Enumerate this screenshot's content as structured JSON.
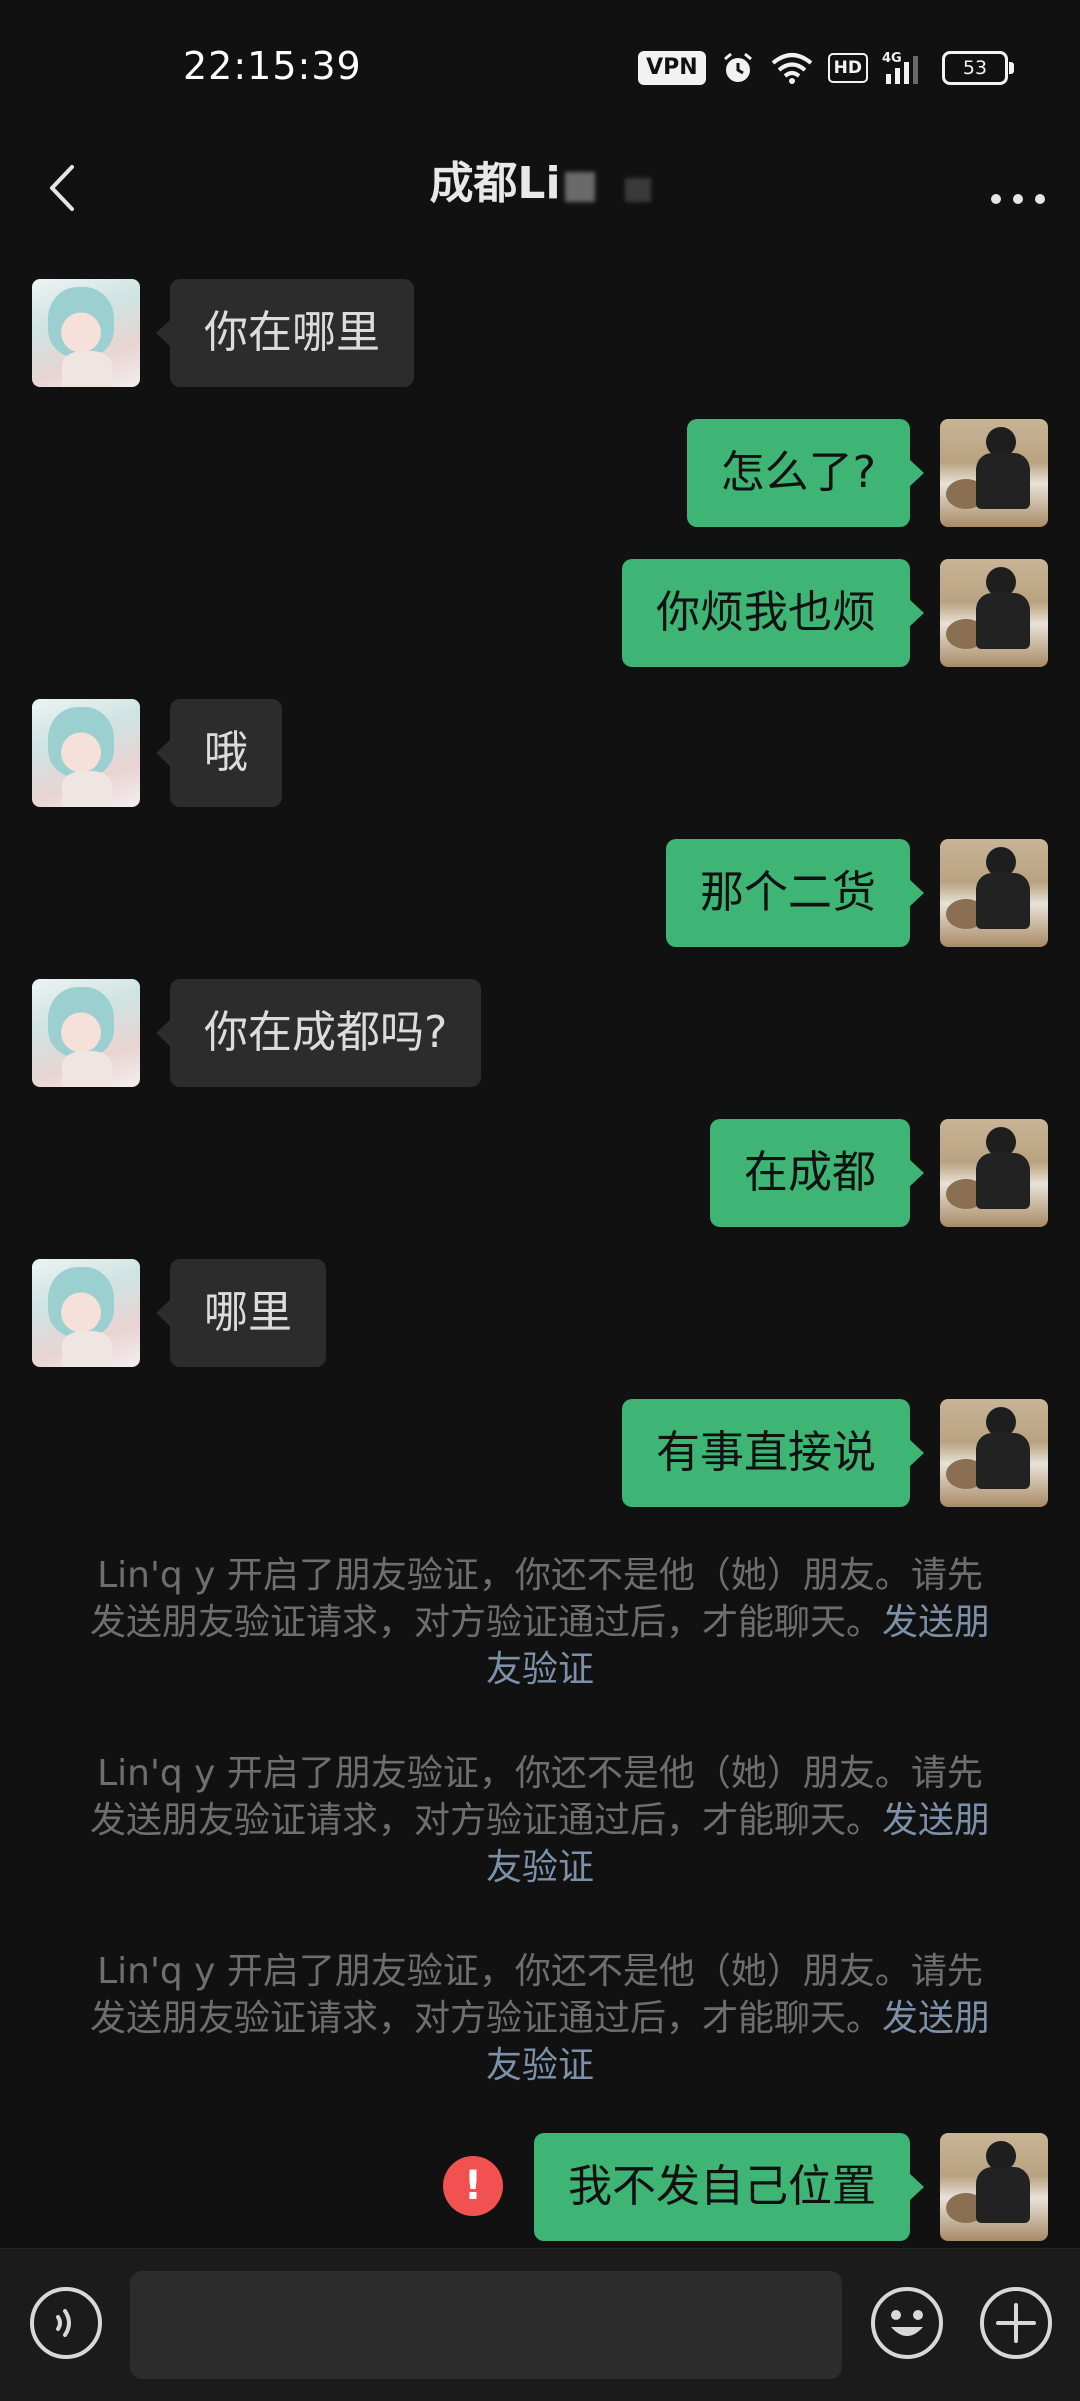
{
  "status_bar": {
    "time": "22:15:39",
    "vpn": "VPN",
    "hd": "HD",
    "network": "4G",
    "battery": "53",
    "icons": [
      "vpn-icon",
      "alarm-icon",
      "wifi-icon",
      "hd-icon",
      "signal-icon",
      "battery-icon"
    ]
  },
  "header": {
    "title": "成都Li",
    "back_icon": "chevron-left-icon",
    "more_icon": "more-horizontal-icon"
  },
  "messages": [
    {
      "side": "left",
      "text": "你在哪里"
    },
    {
      "side": "right",
      "text": "怎么了?"
    },
    {
      "side": "right",
      "text": "你烦我也烦"
    },
    {
      "side": "left",
      "text": "哦"
    },
    {
      "side": "right",
      "text": "那个二货"
    },
    {
      "side": "left",
      "text": "你在成都吗?"
    },
    {
      "side": "right",
      "text": "在成都"
    },
    {
      "side": "left",
      "text": "哪里"
    },
    {
      "side": "right",
      "text": "有事直接说"
    }
  ],
  "system_notices": [
    {
      "text": "Lin'q y 开启了朋友验证，你还不是他（她）朋友。请先发送朋友验证请求，对方验证通过后，才能聊天。",
      "link": "发送朋友验证"
    },
    {
      "text": "Lin'q y 开启了朋友验证，你还不是他（她）朋友。请先发送朋友验证请求，对方验证通过后，才能聊天。",
      "link": "发送朋友验证"
    },
    {
      "text": "Lin'q y 开启了朋友验证，你还不是他（她）朋友。请先发送朋友验证请求，对方验证通过后，才能聊天。",
      "link": "发送朋友验证"
    }
  ],
  "failed_message": {
    "side": "right",
    "text": "我不发自己位置",
    "error_mark": "!"
  },
  "input_bar": {
    "voice_icon": "voice-icon",
    "emoji_icon": "emoji-icon",
    "plus_icon": "plus-circle-icon",
    "text_value": ""
  },
  "colors": {
    "background": "#111111",
    "bubble_self": "#3eb575",
    "bubble_other": "#2c2c2c",
    "notice_text": "#6e6e6e",
    "notice_link": "#7d90a9",
    "error": "#f25151"
  }
}
